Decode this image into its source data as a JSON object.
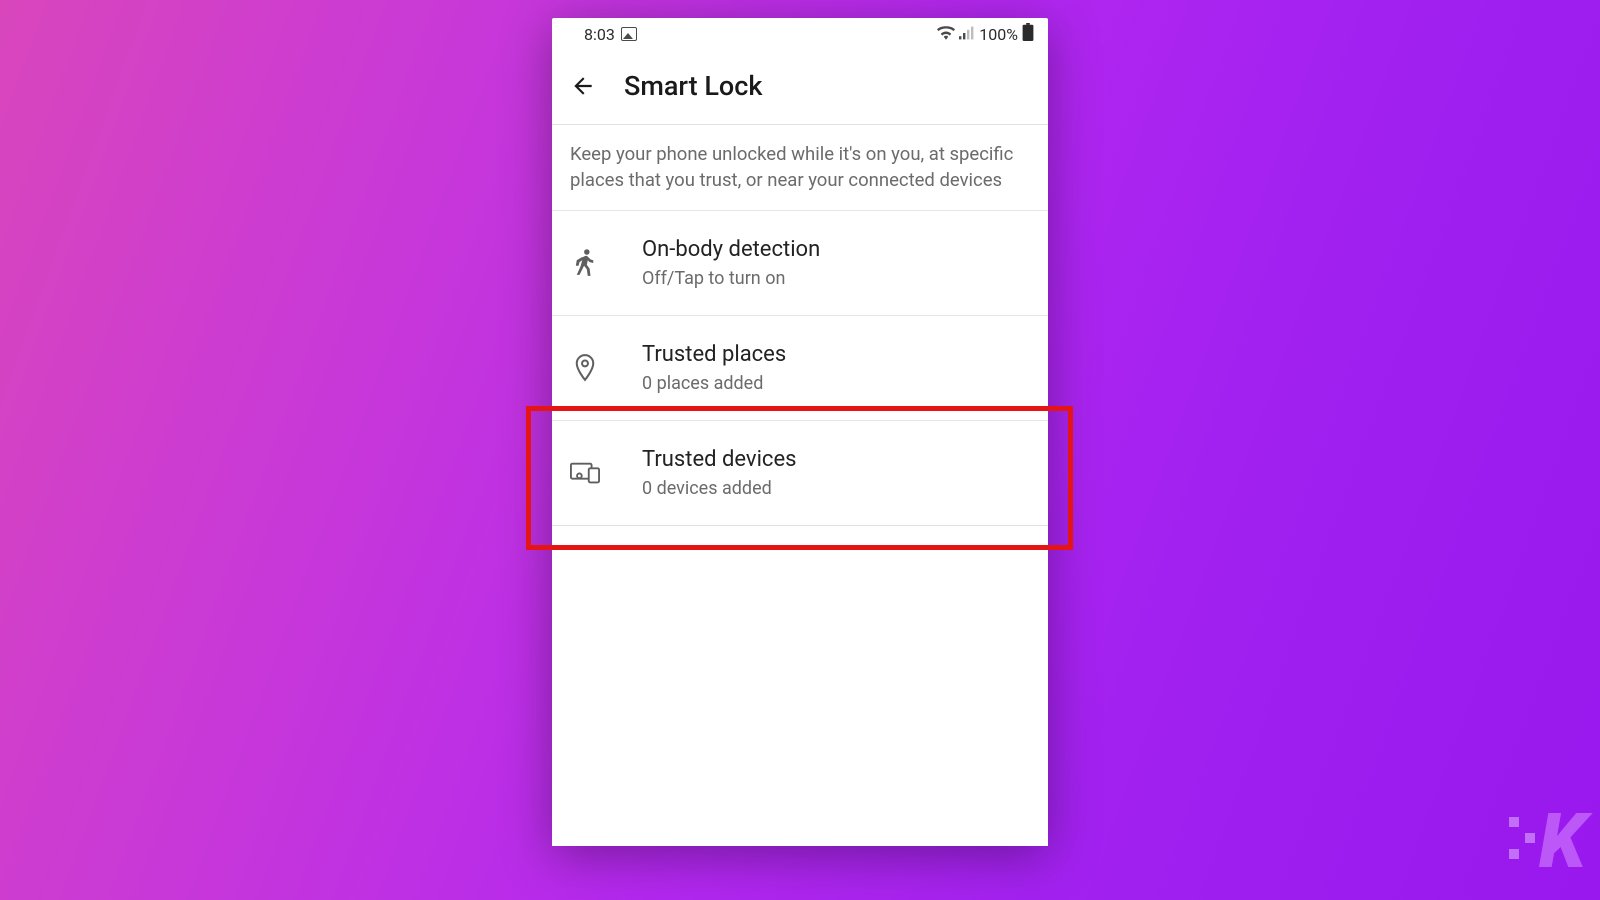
{
  "status": {
    "time": "8:03",
    "battery": "100%"
  },
  "header": {
    "title": "Smart Lock"
  },
  "description": "Keep your phone unlocked while it's on you, at specific places that you trust, or near your connected devices",
  "options": [
    {
      "title": "On-body detection",
      "sub": "Off/Tap to turn on"
    },
    {
      "title": "Trusted places",
      "sub": "0 places added"
    },
    {
      "title": "Trusted devices",
      "sub": "0 devices added"
    }
  ]
}
